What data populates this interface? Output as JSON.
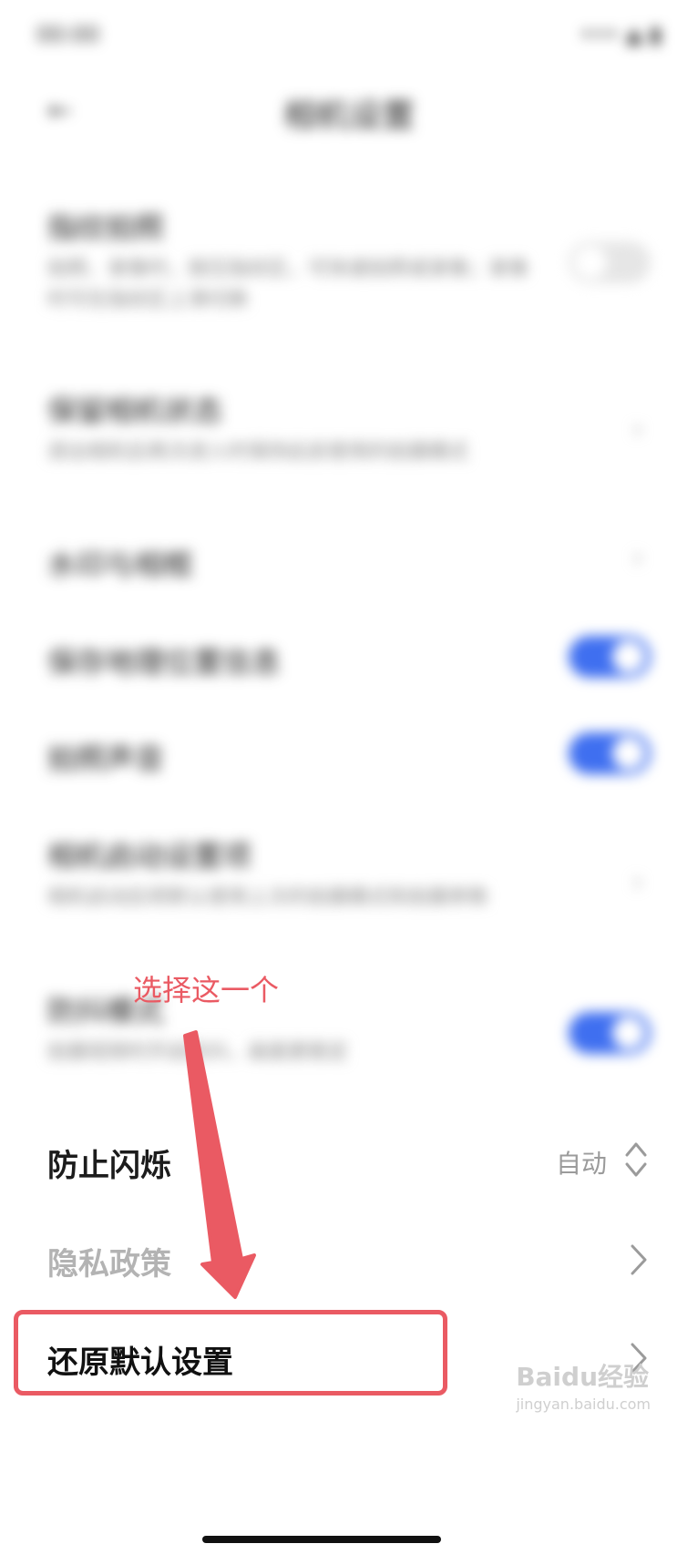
{
  "blurred": {
    "status": {
      "time": "00:00",
      "icons": "••• ▲ ▮"
    },
    "title": "相机设置",
    "rows": [
      {
        "title": "指纹拍照",
        "desc": "拍照、录像时，按压指纹区，可快速拍照或录像；录像时可在指纹区上滑切换",
        "toggle": "off"
      },
      {
        "title": "保留相机状态",
        "desc": "退出相机后再次进入时保持此前使用的拍摄模式",
        "chevron": "›"
      },
      {
        "title": "水印与相框",
        "chevron": "›"
      },
      {
        "title": "保存地理位置信息",
        "toggle": "on"
      },
      {
        "title": "拍照声音",
        "toggle": "on"
      },
      {
        "title": "相机启动设置项",
        "desc": "相机启动后将默认使用上次的拍摄模式和拍摄参数",
        "chevron": "›"
      },
      {
        "title": "防抖模式",
        "desc": "拍摄视频时开启防抖，画面更稳定",
        "toggle": "on"
      }
    ]
  },
  "settings": {
    "flicker": {
      "label": "防止闪烁",
      "value": "自动"
    },
    "privacy": {
      "label": "隐私政策"
    },
    "restore": {
      "label": "还原默认设置"
    }
  },
  "annotation": {
    "text": "选择这一个",
    "color": "#ea5a63"
  },
  "watermark": {
    "text": "Baidu经验",
    "sub": "jingyan.baidu.com"
  }
}
